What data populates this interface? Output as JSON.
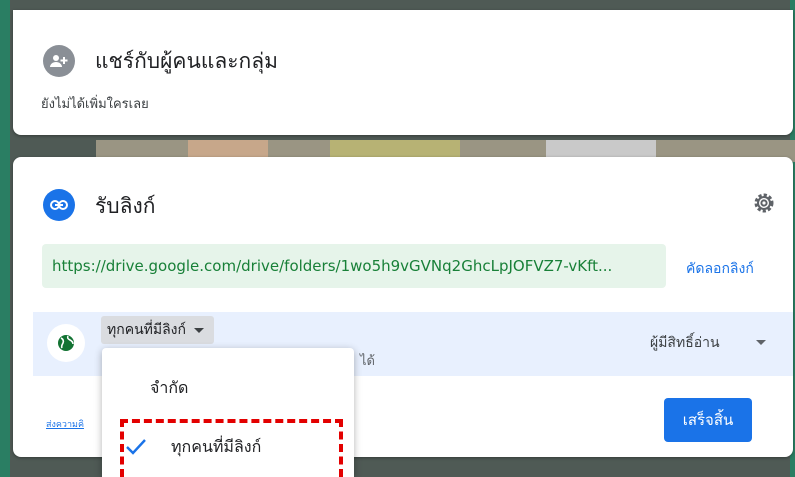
{
  "share_card": {
    "title": "แชร์กับผู้คนและกลุ่ม",
    "subtitle": "ยังไม่ได้เพิ่มใครเลย",
    "icon": "person-add-icon"
  },
  "link_card": {
    "title": "รับลิงก์",
    "icon": "link-icon",
    "settings_icon": "gear-icon",
    "url": "https://drive.google.com/drive/folders/1wo5h9vGVNq2GhcLpJOFVZ7-vKft...",
    "copy_link_label": "คัดลอกลิงก์",
    "access": {
      "icon": "globe-icon",
      "selected": "ทุกคนที่มีลิงก์",
      "description_visible_tail": "ได้",
      "role": "ผู้มีสิทธิ์อ่าน"
    },
    "feedback_label": "ส่งความคิ",
    "done_label": "เสร็จสิ้น"
  },
  "dropdown": {
    "options": [
      {
        "label": "จำกัด",
        "selected": false
      },
      {
        "label": "ทุกคนที่มีลิงก์",
        "selected": true
      }
    ]
  },
  "colors": {
    "accent": "#1a73e8",
    "url_bg": "#e6f4ea",
    "url_text": "#188038",
    "access_row_bg": "#e8f0fe",
    "highlight": "#e30000"
  }
}
